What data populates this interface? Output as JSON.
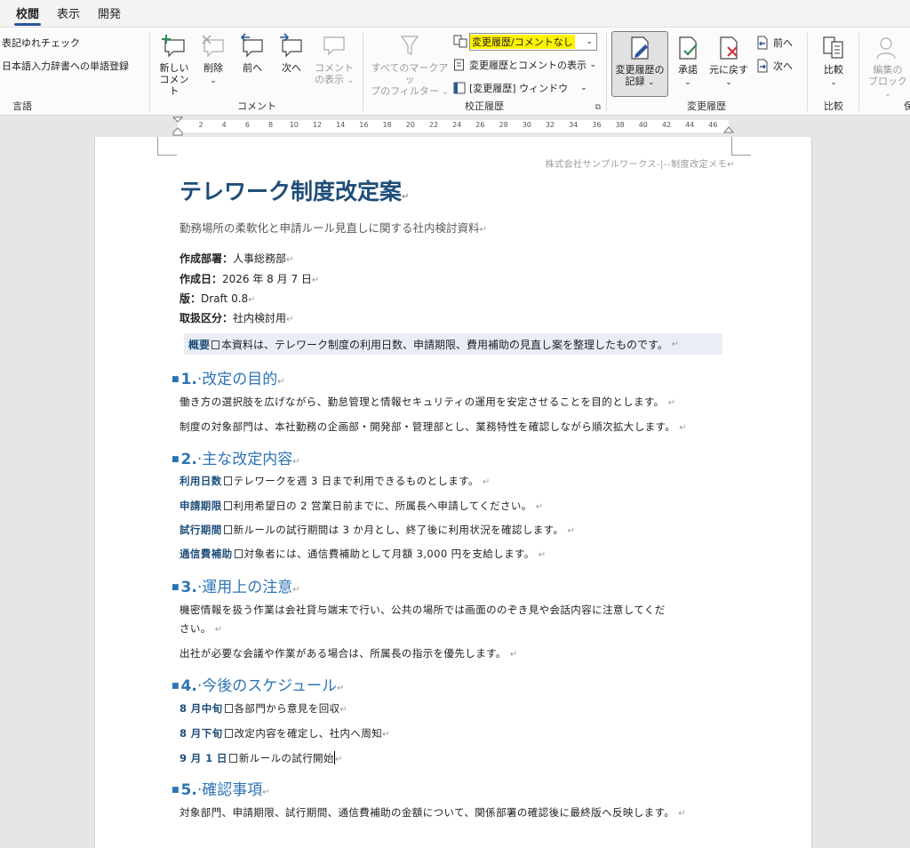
{
  "menu": {
    "items": [
      "校閲",
      "表示",
      "開発"
    ]
  },
  "ribbon": {
    "language": {
      "items": [
        "表記ゆれチェック",
        "日本語入力辞書への単語登録"
      ],
      "label": "言語"
    },
    "comment": {
      "new": [
        "新しい",
        "コメント"
      ],
      "delete": "削除",
      "prev": "前へ",
      "next": "次へ",
      "show": [
        "コメント",
        "の表示"
      ],
      "label": "コメント"
    },
    "tracking": {
      "filter": [
        "すべてのマークアッ",
        "プのフィルター"
      ],
      "markup_select": "変更履歴/コメントなし",
      "show_markup": "変更履歴とコメントの表示",
      "pane": "[変更履歴] ウィンドウ",
      "label": "校正履歴"
    },
    "changes": {
      "record": [
        "変更履歴の",
        "記録"
      ],
      "accept": "承諾",
      "reject": "元に戻す",
      "prev": "前へ",
      "next": "次へ",
      "label": "変更履歴"
    },
    "compare": {
      "btn": "比較",
      "label": "比較"
    },
    "protect": {
      "btn": [
        "編集の",
        "ブロック"
      ],
      "label": "保"
    }
  },
  "ruler": {
    "numbers": [
      "2",
      "4",
      "6",
      "8",
      "10",
      "12",
      "14",
      "16",
      "18",
      "20",
      "22",
      "24",
      "26",
      "28",
      "30",
      "32",
      "34",
      "36",
      "38",
      "40",
      "42",
      "44",
      "46"
    ]
  },
  "doc": {
    "header_note": "株式会社サンプルワークス-|--制度改定メモ",
    "title": "テレワーク制度改定案",
    "subtitle": "勤務場所の柔軟化と申請ルール見直しに関する社内検討資料",
    "meta": [
      {
        "k": "作成部署：",
        "v": "人事総務部"
      },
      {
        "k": "作成日：",
        "v": "2026 年 8 月 7 日"
      },
      {
        "k": "版：",
        "v": "Draft 0.8"
      },
      {
        "k": "取扱区分：",
        "v": "社内検討用"
      }
    ],
    "summary": {
      "k": "概要",
      "v": "本資料は、テレワーク制度の利用日数、申請期限、費用補助の見直し案を整理したものです。"
    },
    "s1": {
      "num": "1.",
      "title": "改定の目的",
      "p1": "働き方の選択肢を広げながら、勤怠管理と情報セキュリティの運用を安定させることを目的とします。",
      "p2": "制度の対象部門は、本社勤務の企画部・開発部・管理部とし、業務特性を確認しながら順次拡大します。"
    },
    "s2": {
      "num": "2.",
      "title": "主な改定内容",
      "items": [
        {
          "k": "利用日数",
          "v": "テレワークを週 3 日まで利用できるものとします。"
        },
        {
          "k": "申請期限",
          "v": "利用希望日の 2 営業日前までに、所属長へ申請してください。"
        },
        {
          "k": "試行期間",
          "v": "新ルールの試行期間は 3 か月とし、終了後に利用状況を確認します。"
        },
        {
          "k": "通信費補助",
          "v": "対象者には、通信費補助として月額 3,000 円を支給します。"
        }
      ]
    },
    "s3": {
      "num": "3.",
      "title": "運用上の注意",
      "p1a": "機密情報を扱う作業は会社貸与端末で行い、公共の場所では画面ののぞき見や会話内容に注意してくだ",
      "p1b": "さい。",
      "p2": "出社が必要な会議や作業がある場合は、所属長の指示を優先します。"
    },
    "s4": {
      "num": "4.",
      "title": "今後のスケジュール",
      "items": [
        {
          "k": "8 月中旬",
          "v": "各部門から意見を回収"
        },
        {
          "k": "8 月下旬",
          "v": "改定内容を確定し、社内へ周知"
        },
        {
          "k": "9 月 1 日",
          "v": "新ルールの試行開始"
        }
      ]
    },
    "s5": {
      "num": "5.",
      "title": "確認事項",
      "p1": "対象部門、申請期限、試行期間、通信費補助の金額について、関係部署の確認後に最終版へ反映します。"
    }
  }
}
